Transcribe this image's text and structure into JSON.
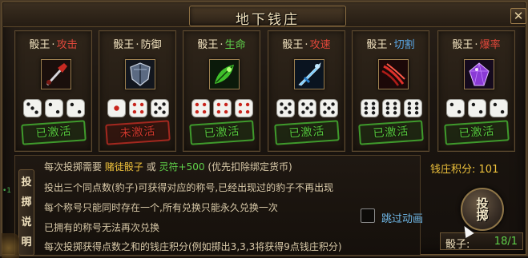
{
  "window": {
    "title": "地下钱庄",
    "close_label": "✕"
  },
  "cards": [
    {
      "prefix": "骰王",
      "attr": "攻击",
      "attr_color": "#e0473a",
      "status": "已激活",
      "status_type": "active",
      "dice": [
        3,
        2,
        2
      ],
      "icon": "red-sword-icon"
    },
    {
      "prefix": "骰王",
      "attr": "防御",
      "attr_color": "#efe0bd",
      "status": "未激活",
      "status_type": "inactive",
      "dice": [
        1,
        4,
        5
      ],
      "icon": "shield-icon"
    },
    {
      "prefix": "骰王",
      "attr": "生命",
      "attr_color": "#5fd14a",
      "status": "已激活",
      "status_type": "active",
      "dice": [
        4,
        4,
        4
      ],
      "icon": "green-leaf-icon"
    },
    {
      "prefix": "骰王",
      "attr": "攻速",
      "attr_color": "#e0473a",
      "status": "已激活",
      "status_type": "active",
      "dice": [
        5,
        5,
        5
      ],
      "icon": "blue-blade-icon"
    },
    {
      "prefix": "骰王",
      "attr": "切割",
      "attr_color": "#5aa7e6",
      "status": "已激活",
      "status_type": "active",
      "dice": [
        6,
        6,
        6
      ],
      "icon": "red-claw-icon"
    },
    {
      "prefix": "骰王",
      "attr": "爆率",
      "attr_color": "#e0473a",
      "status": "已激活",
      "status_type": "active",
      "dice": [
        2,
        2,
        2
      ],
      "icon": "purple-gem-icon"
    }
  ],
  "side_tab": [
    "投",
    "掷",
    "说",
    "明"
  ],
  "info": {
    "line1_pre": "每次投掷需要",
    "line1_item": "赌徒骰子",
    "line1_or": "或",
    "line1_item2": "灵符+500",
    "line1_post": "(优先扣除绑定货币)",
    "line2": "投出三个同点数(豹子)可获得对应的称号,已经出现过的豹子不再出现",
    "line3": "每个称号只能同时存在一个,所有兑换只能永久兑换一次",
    "line4": "已拥有的称号无法再次兑换",
    "line5": "每次投掷获得点数之和的钱庄积分(例如掷出3,3,3将获得9点钱庄积分)"
  },
  "score": {
    "label": "钱庄积分:",
    "value": "101"
  },
  "roll_button": {
    "line1": "投",
    "line2": "掷"
  },
  "skip_animation": {
    "label": "跳过动画",
    "checked": false
  },
  "dice_count": {
    "label": "骰子:",
    "value": "18/1"
  },
  "colors": {
    "active": "#59c93e",
    "inactive": "#d23a2e",
    "highlight": "#f0c33c",
    "link": "#6fb8e8"
  }
}
